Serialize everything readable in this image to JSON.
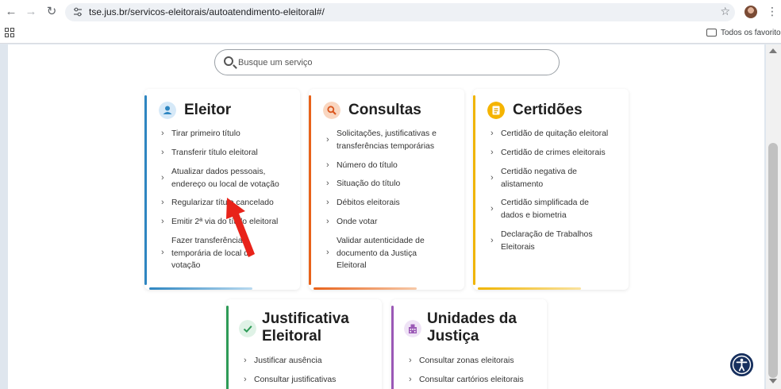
{
  "browser": {
    "url": "tse.jus.br/servicos-eleitorais/autoatendimento-eleitoral#/",
    "bookmarks_folder": "Todos os favoritos"
  },
  "search": {
    "placeholder": "Busque um serviço"
  },
  "cards": {
    "eleitor": {
      "title": "Eleitor",
      "accent": "#2e86c1",
      "items": [
        "Tirar primeiro título",
        "Transferir título eleitoral",
        "Atualizar dados pessoais,",
        "endereço ou local de votação",
        "Regularizar título cancelado",
        "Emitir 2ª via do título eleitoral",
        "Fazer transferência",
        "temporária de local de",
        "votação"
      ]
    },
    "consultas": {
      "title": "Consultas",
      "accent": "#e8621a",
      "items": [
        "Solicitações, justificativas e",
        "transferências temporárias",
        "Número do título",
        "Situação do título",
        "Débitos eleitorais",
        "Onde votar",
        "Validar autenticidade de",
        "documento da Justiça",
        "Eleitoral"
      ]
    },
    "certidoes": {
      "title": "Certidões",
      "accent": "#f0b400",
      "items": [
        "Certidão de quitação eleitoral",
        "Certidão de crimes eleitorais",
        "Certidão negativa de",
        "alistamento",
        "Certidão simplificada de",
        "dados e biometria",
        "Declaração de Trabalhos",
        "Eleitorais"
      ]
    },
    "justificativa": {
      "title_line1": "Justificativa",
      "title_line2": "Eleitoral",
      "accent": "#2e9b57",
      "items": [
        "Justificar ausência",
        "Consultar justificativas"
      ]
    },
    "unidades": {
      "title_line1": "Unidades da",
      "title_line2": "Justiça",
      "accent": "#9b59b6",
      "items": [
        "Consultar zonas eleitorais",
        "Consultar cartórios eleitorais"
      ]
    }
  },
  "icons": {
    "eleitor": "person-icon",
    "consultas": "magnifier-icon",
    "certidoes": "document-icon",
    "justificativa": "check-icon",
    "unidades": "building-icon",
    "accessibility": "accessibility-icon",
    "annotation": "red-arrow"
  }
}
